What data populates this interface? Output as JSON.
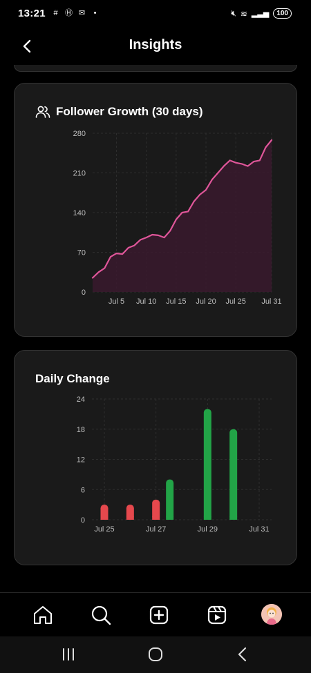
{
  "status_bar": {
    "time": "13:21",
    "battery": "100"
  },
  "header": {
    "title": "Insights",
    "back_icon": "chevron-left-icon"
  },
  "follower_growth": {
    "title": "Follower Growth (30 days)",
    "icon": "users-icon",
    "chart_data": {
      "type": "area",
      "title": "Follower Growth (30 days)",
      "color": "#e0569a",
      "fill": "#3a1a2e",
      "x_ticks": [
        "Jul 5",
        "Jul 10",
        "Jul 15",
        "Jul 20",
        "Jul 25",
        "Jul 31"
      ],
      "y_ticks": [
        "0",
        "70",
        "140",
        "210",
        "280"
      ],
      "ylim": [
        0,
        280
      ],
      "grid": true,
      "x": [
        "Jul 1",
        "Jul 2",
        "Jul 3",
        "Jul 4",
        "Jul 5",
        "Jul 6",
        "Jul 7",
        "Jul 8",
        "Jul 9",
        "Jul 10",
        "Jul 11",
        "Jul 12",
        "Jul 13",
        "Jul 14",
        "Jul 15",
        "Jul 16",
        "Jul 17",
        "Jul 18",
        "Jul 19",
        "Jul 20",
        "Jul 21",
        "Jul 22",
        "Jul 23",
        "Jul 24",
        "Jul 25",
        "Jul 26",
        "Jul 27",
        "Jul 28",
        "Jul 29",
        "Jul 30",
        "Jul 31"
      ],
      "values": [
        25,
        35,
        42,
        62,
        68,
        67,
        78,
        82,
        92,
        96,
        101,
        100,
        96,
        108,
        128,
        140,
        142,
        160,
        172,
        180,
        198,
        210,
        222,
        232,
        228,
        226,
        222,
        230,
        232,
        255,
        268
      ]
    }
  },
  "daily_change": {
    "title": "Daily Change",
    "chart_data": {
      "type": "bar",
      "title": "Daily Change",
      "categories": [
        "Jul 25",
        "Jul 26",
        "Jul 27",
        "Jul 28",
        "Jul 29",
        "Jul 30",
        "Jul 31"
      ],
      "x_ticks": [
        "Jul 25",
        "Jul 27",
        "Jul 29",
        "Jul 31"
      ],
      "y_ticks": [
        "0",
        "6",
        "12",
        "18",
        "24"
      ],
      "ylim": [
        0,
        24
      ],
      "grid": true,
      "series": [
        {
          "values": [
            -3,
            -3,
            -4,
            0,
            0,
            0,
            0
          ],
          "color": "#e5484d"
        },
        {
          "values": [
            0,
            0,
            8,
            0,
            22,
            18,
            0
          ],
          "color": "#22a447"
        }
      ],
      "bars": [
        {
          "category": "Jul 25",
          "value": -3,
          "color": "#e5484d"
        },
        {
          "category": "Jul 26",
          "value": -3,
          "color": "#e5484d"
        },
        {
          "category": "Jul 27",
          "value": -4,
          "color": "#e5484d"
        },
        {
          "category": "Jul 27",
          "value": 8,
          "color": "#22a447"
        },
        {
          "category": "Jul 29",
          "value": 22,
          "color": "#22a447"
        },
        {
          "category": "Jul 30",
          "value": 18,
          "color": "#22a447"
        }
      ]
    }
  },
  "bottom_nav": {
    "items": [
      "home-icon",
      "search-icon",
      "add-post-icon",
      "reels-icon",
      "profile-avatar"
    ]
  },
  "system_nav": {
    "items": [
      "recents-icon",
      "home-circle-icon",
      "back-icon"
    ]
  }
}
